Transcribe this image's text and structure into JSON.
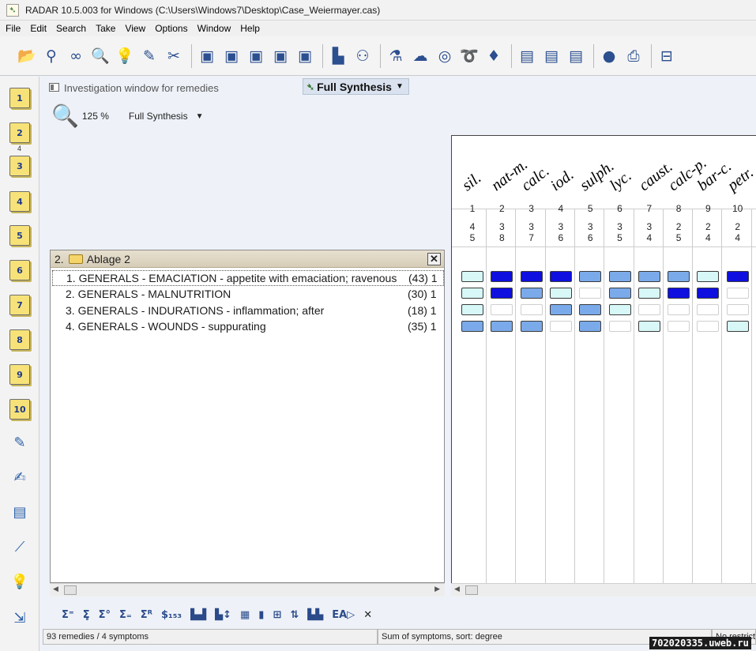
{
  "window": {
    "title": "RADAR 10.5.003 for Windows  (C:\\Users\\Windows7\\Desktop\\Case_Weiermayer.cas)"
  },
  "menubar": [
    "File",
    "Edit",
    "Search",
    "Take",
    "View",
    "Options",
    "Window",
    "Help"
  ],
  "toolbar_icons": [
    "open-case-icon",
    "binoculars-icon",
    "glasses-icon",
    "magnifier-icon",
    "lightbulb-icon",
    "hint-icon",
    "scissors-icon",
    "clipboard-1-icon",
    "clipboard-2-icon",
    "clipboard-3-icon",
    "clipboard-4-icon",
    "clipboard-5-icon",
    "bar-chart-icon",
    "family-icon",
    "flask-icon",
    "cloud-icon",
    "lifebuoy-icon",
    "spiral-icon",
    "crystal-icon",
    "book-1-icon",
    "book-2-icon",
    "book-3-icon",
    "globe-icon",
    "printer-icon",
    "plug-icon"
  ],
  "left_toolbar": {
    "clipboards": [
      "1",
      "2",
      "3",
      "4",
      "5",
      "6",
      "7",
      "8",
      "9",
      "10"
    ],
    "clipboard_2_count": "4",
    "tools": [
      "pencil-icon",
      "notepad-icon",
      "documents-icon",
      "graph-icon",
      "idea-icon",
      "exit-icon"
    ]
  },
  "investigation": {
    "title": "Investigation window for remedies",
    "repertory_dropdown": "Full Synthesis",
    "zoom": "125 %",
    "repertory_select": "Full Synthesis"
  },
  "clipboard": {
    "header": "2.",
    "name": "Ablage 2",
    "close_glyph": "✕",
    "rubrics": [
      {
        "text": "1. GENERALS - EMACIATION - appetite with emaciation; ravenous",
        "count": "(43) 1"
      },
      {
        "text": "2. GENERALS - MALNUTRITION",
        "count": "(30) 1"
      },
      {
        "text": "3. GENERALS - INDURATIONS - inflammation; after",
        "count": "(18) 1"
      },
      {
        "text": "4. GENERALS - WOUNDS - suppurating",
        "count": "(35) 1"
      }
    ]
  },
  "grid": {
    "remedies": [
      {
        "name": "sil.",
        "num": "1",
        "score": "4",
        "degree": "5"
      },
      {
        "name": "nat-m.",
        "num": "2",
        "score": "3",
        "degree": "8"
      },
      {
        "name": "calc.",
        "num": "3",
        "score": "3",
        "degree": "7"
      },
      {
        "name": "iod.",
        "num": "4",
        "score": "3",
        "degree": "6"
      },
      {
        "name": "sulph.",
        "num": "5",
        "score": "3",
        "degree": "6"
      },
      {
        "name": "lyc.",
        "num": "6",
        "score": "3",
        "degree": "5"
      },
      {
        "name": "caust.",
        "num": "7",
        "score": "3",
        "degree": "4"
      },
      {
        "name": "calc-p.",
        "num": "8",
        "score": "2",
        "degree": "5"
      },
      {
        "name": "bar-c.",
        "num": "9",
        "score": "2",
        "degree": "4"
      },
      {
        "name": "petr.",
        "num": "10",
        "score": "2",
        "degree": "4"
      }
    ],
    "cell_grades": [
      [
        1,
        3,
        3,
        3,
        2,
        2,
        2,
        2,
        1,
        3
      ],
      [
        1,
        3,
        2,
        1,
        0,
        2,
        1,
        3,
        3,
        0
      ],
      [
        1,
        0,
        0,
        2,
        2,
        1,
        0,
        0,
        0,
        0
      ],
      [
        2,
        2,
        2,
        0,
        2,
        0,
        1,
        0,
        0,
        1
      ]
    ],
    "grade_colors": [
      "#ffffff",
      "#d8f7f7",
      "#7aaaea",
      "#0f0fe0"
    ]
  },
  "bottom_toolbar": [
    "Σ⁼",
    "Σ̥",
    "Σ°",
    "Σ₌",
    "Σᴿ",
    "$₁₅₃",
    "▙▟",
    "▙↕",
    "▦",
    "▮",
    "⊞",
    "⇅",
    "▙▙",
    "EA▷",
    "✕"
  ],
  "status": {
    "left": "93 remedies / 4 symptoms",
    "middle": "Sum of symptoms, sort: degree",
    "right": "No restrict"
  },
  "watermark": "702020335.uweb.ru"
}
